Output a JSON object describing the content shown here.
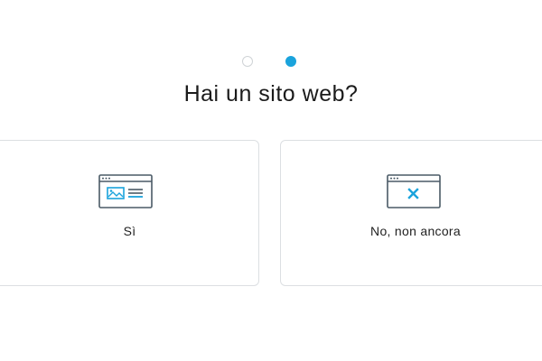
{
  "progress": {
    "total_steps": 2,
    "current_step": 2
  },
  "title": "Hai un sito web?",
  "options": [
    {
      "label": "Sì",
      "icon": "website-icon"
    },
    {
      "label": "No, non ancora",
      "icon": "website-x-icon"
    }
  ],
  "colors": {
    "accent": "#1aa3dc",
    "icon_stroke": "#4a5a66",
    "border": "#dcdfe2"
  }
}
